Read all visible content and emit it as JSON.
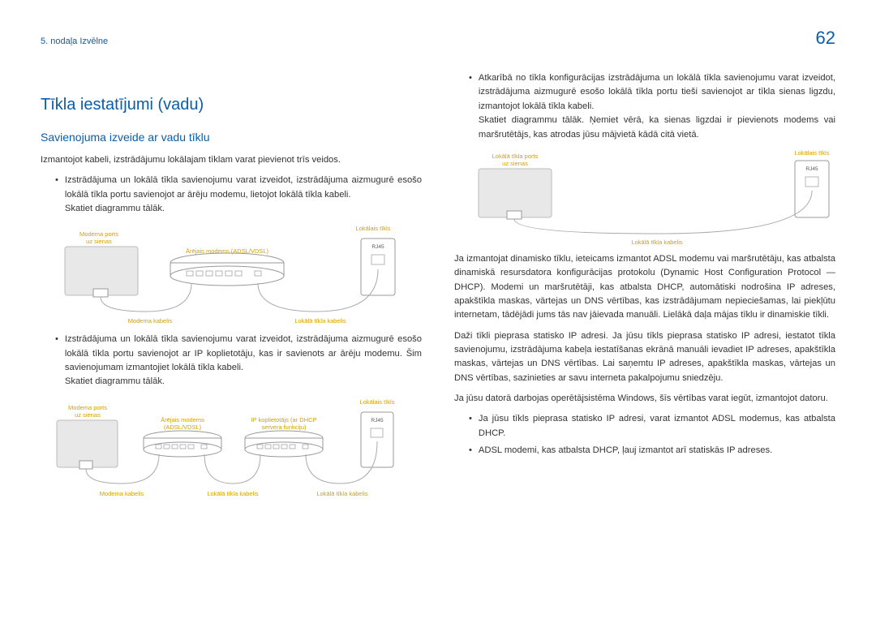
{
  "breadcrumb": "5. nodaļa Izvēlne",
  "page_number": "62",
  "title": "Tīkla iestatījumi (vadu)",
  "subtitle": "Savienojuma izveide ar vadu tīklu",
  "intro": "Izmantojot kabeli, izstrādājumu lokālajam tīklam varat pievienot trīs veidos.",
  "b1": "Izstrādājuma un lokālā tīkla savienojumu varat izveidot, izstrādājuma aizmugurē esošo lokālā tīkla portu savienojot ar ārēju modemu, lietojot lokālā tīkla kabeli.",
  "see1": "Skatiet diagrammu tālāk.",
  "b2": "Izstrādājuma un lokālā tīkla savienojumu varat izveidot, izstrādājuma aizmugurē esošo lokālā tīkla portu savienojot ar IP koplietotāju, kas ir savienots ar ārēju modemu. Šim savienojumam izmantojiet lokālā tīkla kabeli.",
  "see2": "Skatiet diagrammu tālāk.",
  "b3": "Atkarībā no tīkla konfigurācijas izstrādājuma un lokālā tīkla savienojumu varat izveidot, izstrādājuma aizmugurē esošo lokālā tīkla portu tieši savienojot ar tīkla sienas ligzdu, izmantojot lokālā tīkla kabeli.",
  "see3": "Skatiet diagrammu tālāk. Ņemiet vērā, ka sienas ligzdai ir pievienots modems vai maršrutētājs, kas atrodas jūsu mājvietā kādā citā vietā.",
  "p4": "Ja izmantojat dinamisko tīklu, ieteicams izmantot ADSL modemu vai maršrutētāju, kas atbalsta dinamiskā resursdatora konfigurācijas protokolu (Dynamic Host Configuration Protocol — DHCP). Modemi un maršrutētāji, kas atbalsta DHCP, automātiski nodrošina IP adreses, apakštīkla maskas, vārtejas un DNS vērtības, kas izstrādājumam nepieciešamas, lai piekļūtu internetam, tādējādi jums tās nav jāievada manuāli. Lielākā daļa mājas tīklu ir dinamiskie tīkli.",
  "p5": "Daži tīkli pieprasa statisko IP adresi. Ja jūsu tīkls pieprasa statisko IP adresi, iestatot tīkla savienojumu, izstrādājuma kabeļa iestatīšanas ekrānā manuāli ievadiet IP adreses, apakštīkla maskas, vārtejas un DNS vērtības. Lai saņemtu IP adreses, apakštīkla maskas, vārtejas un DNS vērtības, sazinieties ar savu interneta pakalpojumu sniedzēju.",
  "p6": "Ja jūsu datorā darbojas operētājsistēma Windows, šīs vērtības varat iegūt, izmantojot datoru.",
  "b4": "Ja jūsu tīkls pieprasa statisko IP adresi, varat izmantot ADSL modemus, kas atbalsta DHCP.",
  "b5": "ADSL modemi, kas atbalsta DHCP, ļauj izmantot arī statiskās IP adreses.",
  "diagram_labels": {
    "modem_port_wall": "Modema ports",
    "on_wall": "uz sienas",
    "external_modem": "Ārējais modems (ADSL/VDSL)",
    "external_modem_split1": "Ārējais modems",
    "external_modem_split2": "(ADSL/VDSL)",
    "lan": "Lokālais tīkls",
    "rj45": "RJ45",
    "modem_cable": "Modema kabelis",
    "lan_cable": "Lokālā tīkla kabelis",
    "ip_sharer1": "IP koplietotājs (ar DHCP",
    "ip_sharer2": "servera funkciju)",
    "lan_port_wall": "Lokālā tīkla ports",
    "on_wall2": "uz sienas"
  }
}
